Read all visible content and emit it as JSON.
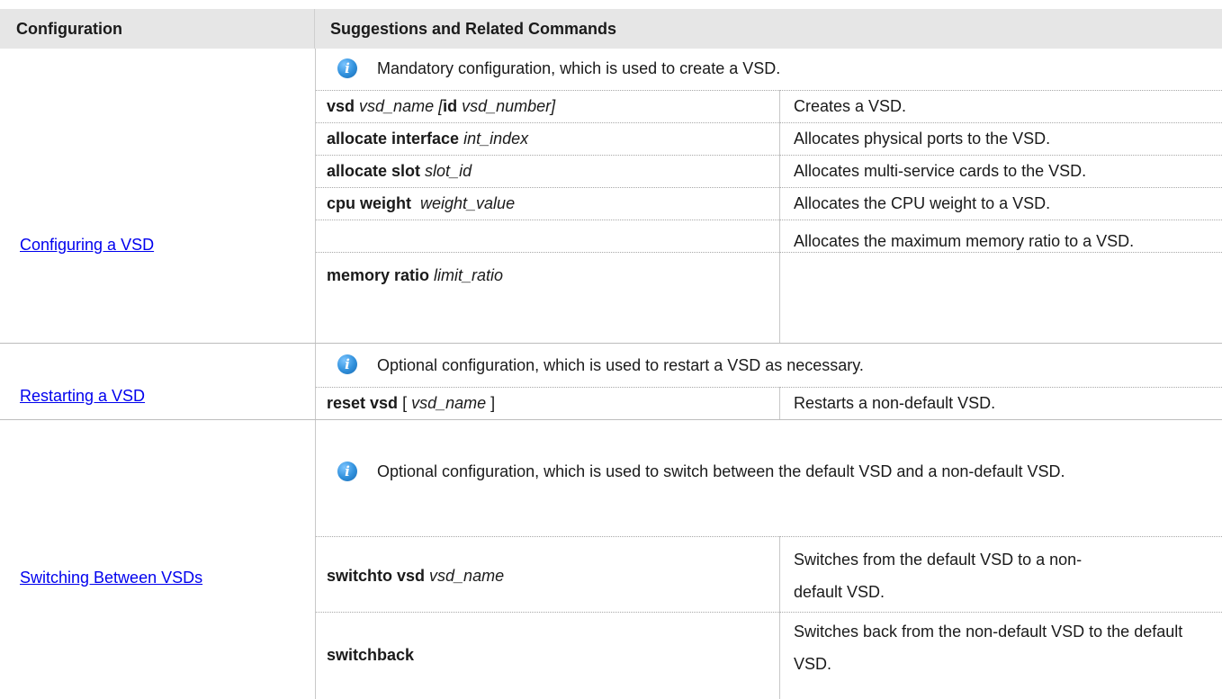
{
  "header": {
    "col1": "Configuration",
    "col2": "Suggestions and Related Commands"
  },
  "sections": [
    {
      "link": "Configuring a VSD",
      "note": "Mandatory configuration, which is used to create a VSD.",
      "rows": [
        {
          "cmd_bold": "vsd",
          "cmd_rest": " vsd_name [",
          "cmd_bold2": "id",
          "cmd_rest2": " vsd_number]",
          "desc": "Creates a VSD."
        },
        {
          "cmd_bold": "allocate interface",
          "cmd_rest": " int_index",
          "desc": "Allocates physical ports to the VSD."
        },
        {
          "cmd_bold": "allocate slot",
          "cmd_rest": " slot_id",
          "desc": "Allocates multi-service cards to the VSD."
        },
        {
          "cmd_bold": "cpu weight",
          "cmd_rest": "  weight_value",
          "desc": "Allocates the CPU weight to a VSD."
        },
        {
          "cmd_bold": "memory ratio",
          "cmd_rest": " limit_ratio",
          "desc": "Allocates the maximum memory ratio to a VSD."
        }
      ]
    },
    {
      "link": "Restarting a VSD",
      "note": "Optional configuration, which is used to restart a VSD as necessary.",
      "rows": [
        {
          "cmd_bold": "reset vsd",
          "cmd_plain": " [ ",
          "cmd_rest": "vsd_name",
          "cmd_plain2": " ]",
          "desc": "Restarts a non-default VSD."
        }
      ]
    },
    {
      "link": "Switching Between VSDs",
      "note": "Optional configuration, which is used to switch between the default VSD and a non-default VSD.",
      "rows": [
        {
          "cmd_bold": "switchto vsd",
          "cmd_rest": " vsd_name",
          "desc": "Switches from the default VSD to a non-default VSD."
        },
        {
          "cmd_bold": "switchback",
          "desc": "Switches back from the non-default VSD to the default VSD."
        }
      ]
    }
  ]
}
